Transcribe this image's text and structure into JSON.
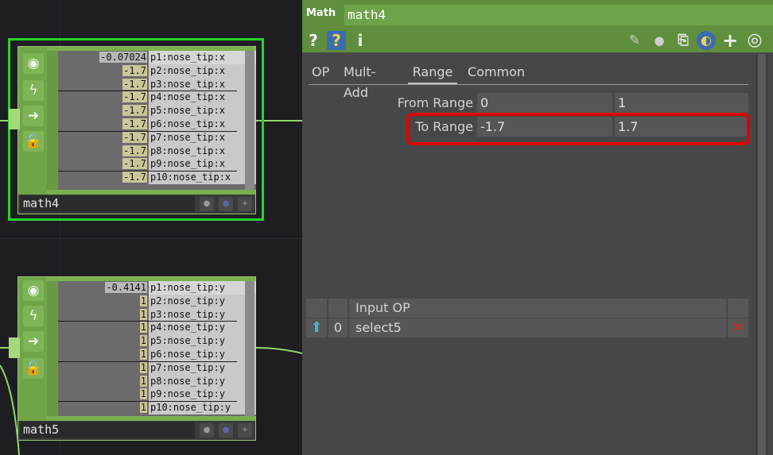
{
  "canvas": {
    "nodes": [
      {
        "name": "math4",
        "selected": true,
        "rows": [
          {
            "value": "-0.07024",
            "channel": "p1:nose_tip:x"
          },
          {
            "value": "-1.7",
            "channel": "p2:nose_tip:x"
          },
          {
            "value": "-1.7",
            "channel": "p3:nose_tip:x"
          },
          {
            "value": "-1.7",
            "channel": "p4:nose_tip:x"
          },
          {
            "value": "-1.7",
            "channel": "p5:nose_tip:x"
          },
          {
            "value": "-1.7",
            "channel": "p6:nose_tip:x"
          },
          {
            "value": "-1.7",
            "channel": "p7:nose_tip:x"
          },
          {
            "value": "-1.7",
            "channel": "p8:nose_tip:x"
          },
          {
            "value": "-1.7",
            "channel": "p9:nose_tip:x"
          },
          {
            "value": "-1.7",
            "channel": "p10:nose_tip:x"
          }
        ]
      },
      {
        "name": "math5",
        "selected": false,
        "rows": [
          {
            "value": "-0.4141",
            "channel": "p1:nose_tip:y"
          },
          {
            "value": "1",
            "channel": "p2:nose_tip:y"
          },
          {
            "value": "1",
            "channel": "p3:nose_tip:y"
          },
          {
            "value": "1",
            "channel": "p4:nose_tip:y"
          },
          {
            "value": "1",
            "channel": "p5:nose_tip:y"
          },
          {
            "value": "1",
            "channel": "p6:nose_tip:y"
          },
          {
            "value": "1",
            "channel": "p7:nose_tip:y"
          },
          {
            "value": "1",
            "channel": "p8:nose_tip:y"
          },
          {
            "value": "1",
            "channel": "p9:nose_tip:y"
          },
          {
            "value": "1",
            "channel": "p10:nose_tip:y"
          }
        ]
      }
    ],
    "rail_icons": [
      "viewer-icon",
      "bypass-icon",
      "clone-icon",
      "lock-icon"
    ]
  },
  "panel": {
    "op_type": "Math",
    "op_name": "math4",
    "toolbar_left": [
      {
        "icon": "help-icon",
        "glyph": "?"
      },
      {
        "icon": "python-help-icon",
        "glyph": "?"
      },
      {
        "icon": "info-icon",
        "glyph": "i"
      }
    ],
    "toolbar_right": [
      {
        "icon": "edit-icon",
        "glyph": "✎"
      },
      {
        "icon": "comment-icon",
        "glyph": "💬"
      },
      {
        "icon": "clipboard-icon",
        "glyph": "📋"
      },
      {
        "icon": "python-icon",
        "glyph": "🐍"
      },
      {
        "icon": "add-icon",
        "glyph": "+"
      },
      {
        "icon": "target-icon",
        "glyph": "◎"
      }
    ],
    "tabs": [
      "OP",
      "Mult-Add",
      "Range",
      "Common"
    ],
    "active_tab": "Range",
    "params": {
      "from_range": {
        "label": "From Range",
        "v1": "0",
        "v2": "1"
      },
      "to_range": {
        "label": "To Range",
        "v1": "-1.7",
        "v2": "1.7"
      }
    },
    "input_table": {
      "header": "Input OP",
      "rows": [
        {
          "index": "0",
          "op": "select5"
        }
      ]
    }
  },
  "colors": {
    "node_green": "#79b04f",
    "selection_green": "#27d32a",
    "highlight_red": "#e00000",
    "panel_title_green": "#5f8f3c"
  }
}
